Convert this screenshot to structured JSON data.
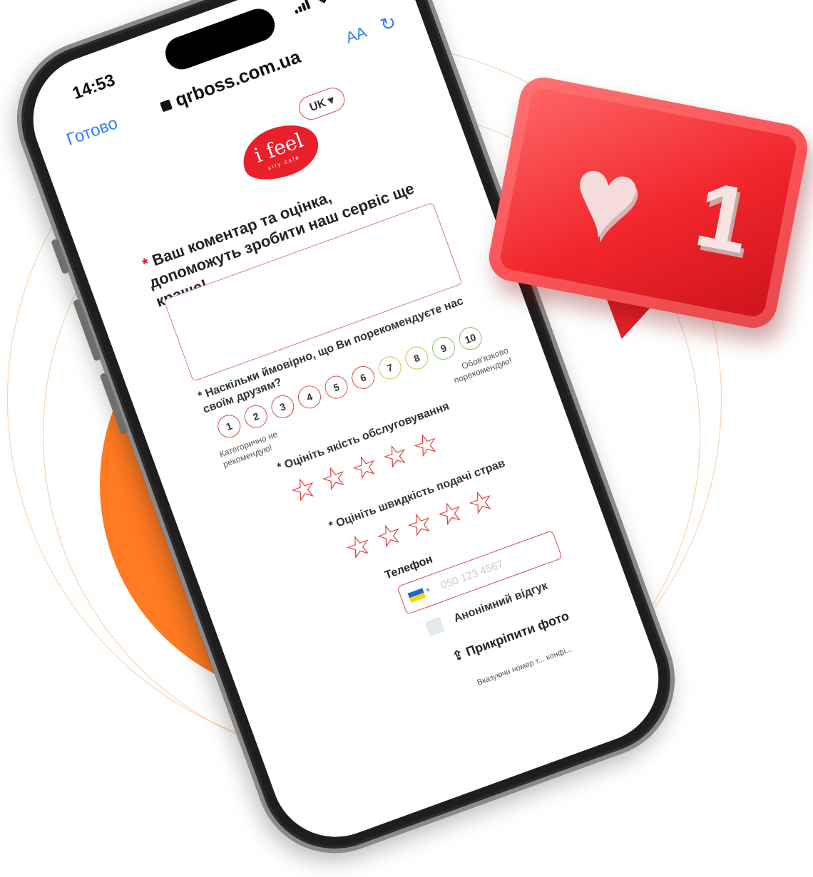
{
  "status_bar": {
    "time": "14:53"
  },
  "browser": {
    "done_label": "Готово",
    "url": "qrboss.com.ua",
    "text_size_label": "AA"
  },
  "form": {
    "language": "UK",
    "logo_text": "i feel",
    "logo_sub": "city cafe",
    "comment_question": "Ваш коментар та оцінка, допоможуть зробити наш сервіс ще краще!",
    "recommend_question": "* Наскільки ймовірно, що Ви порекомендуєте нас своїм друзям?",
    "scale": [
      "1",
      "2",
      "3",
      "4",
      "5",
      "6",
      "7",
      "8",
      "9",
      "10"
    ],
    "scale_low_label": "Категорично не рекомендую!",
    "scale_high_label": "Обов'язково порекомендую!",
    "service_question": "* Оцініть якість обслуговування",
    "service_rating": 0,
    "speed_question": "* Оцініть швидкість подачі страв",
    "speed_rating": 0,
    "phone_label": "Телефон",
    "phone_placeholder": "050 123 4567",
    "anonymous_label": "Анонімний відгук",
    "anonymous_checked": false,
    "attach_label": "Прикріпити фото",
    "note_text": "Вказуючи номер т... конфі..."
  },
  "notification": {
    "count": "1",
    "icon": "heart-icon"
  },
  "colors": {
    "accent": "#e8202a",
    "orange": "#ff7a22",
    "link": "#2f7ff5"
  }
}
